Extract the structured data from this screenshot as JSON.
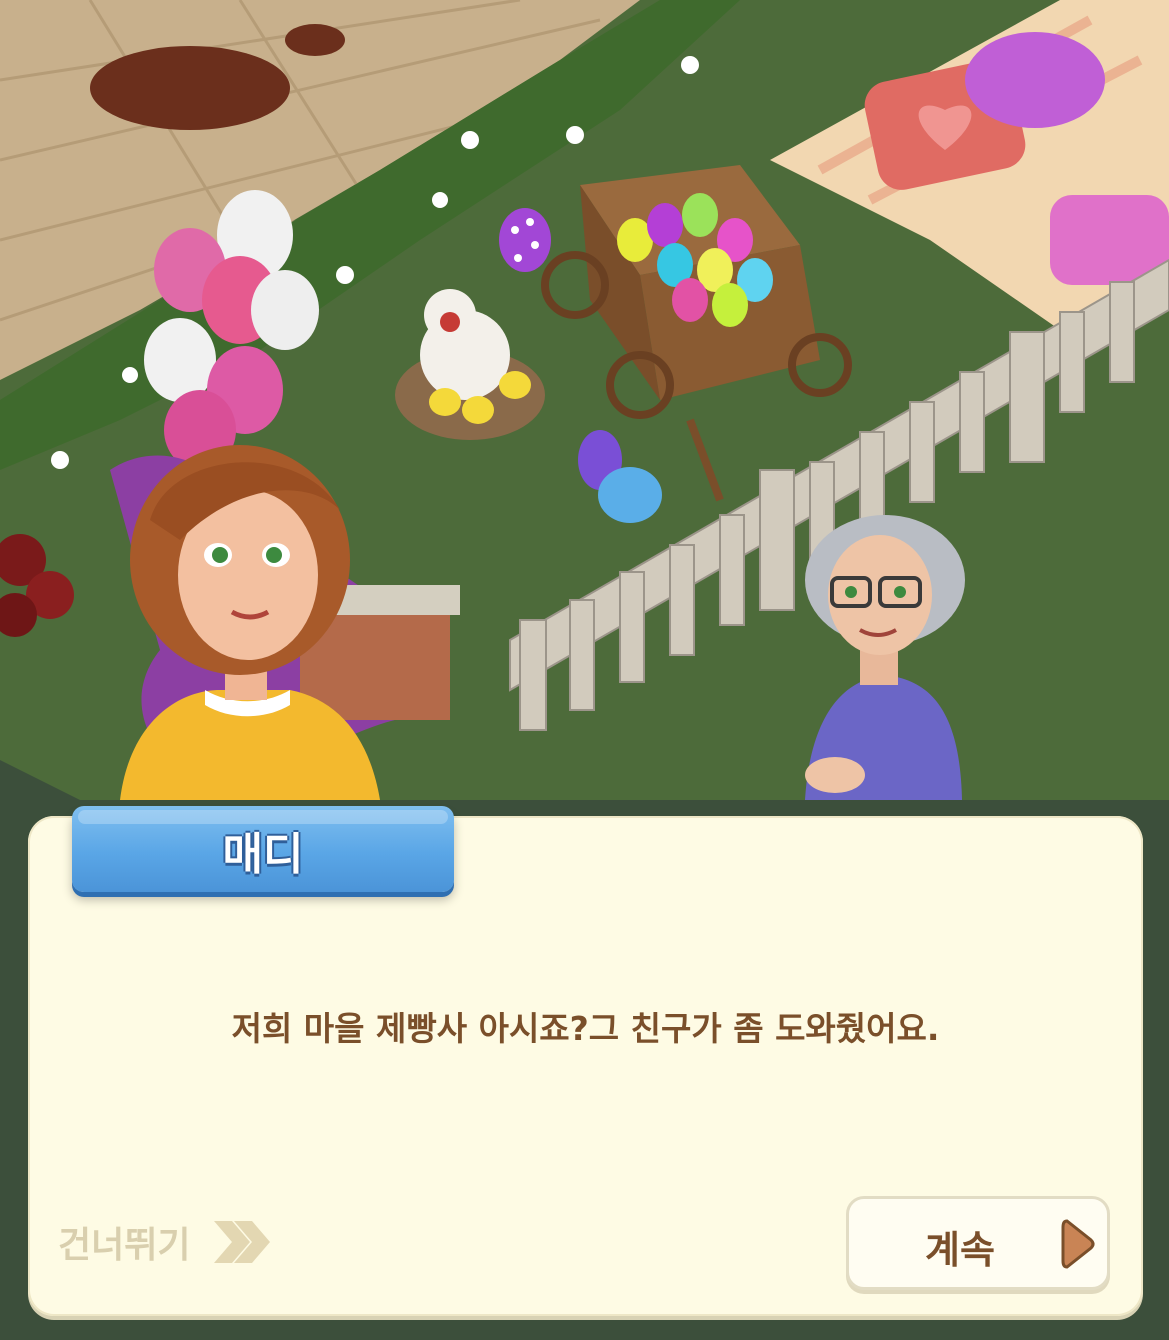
{
  "dialog": {
    "speaker": "매디",
    "text": "저희 마을 제빵사 아시죠?그 친구가 좀 도와줬어요.",
    "skip_label": "건너뛰기",
    "continue_label": "계속"
  },
  "colors": {
    "name_tab": "#5aa6e6",
    "dialog_bg": "#fefbe4",
    "dialog_text": "#7a4f2a",
    "skip_text": "#d9cfae",
    "continue_arrow": "#c98455"
  },
  "icons": {
    "skip": "double-chevron-right-icon",
    "continue": "play-triangle-icon"
  }
}
